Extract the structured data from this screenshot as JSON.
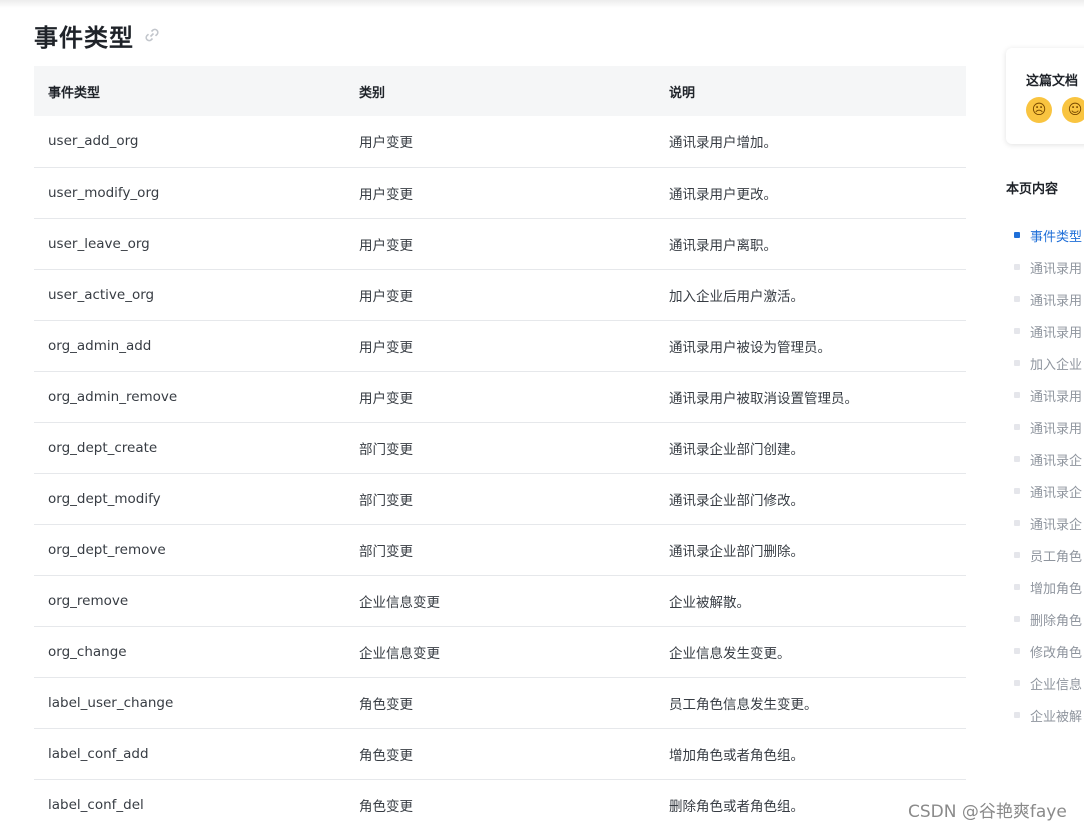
{
  "header": {
    "title": "事件类型",
    "link_icon": "link-icon"
  },
  "table": {
    "columns": [
      "事件类型",
      "类别",
      "说明"
    ],
    "rows": [
      [
        "user_add_org",
        "用户变更",
        "通讯录用户增加。"
      ],
      [
        "user_modify_org",
        "用户变更",
        "通讯录用户更改。"
      ],
      [
        "user_leave_org",
        "用户变更",
        "通讯录用户离职。"
      ],
      [
        "user_active_org",
        "用户变更",
        "加入企业后用户激活。"
      ],
      [
        "org_admin_add",
        "用户变更",
        "通讯录用户被设为管理员。"
      ],
      [
        "org_admin_remove",
        "用户变更",
        "通讯录用户被取消设置管理员。"
      ],
      [
        "org_dept_create",
        "部门变更",
        "通讯录企业部门创建。"
      ],
      [
        "org_dept_modify",
        "部门变更",
        "通讯录企业部门修改。"
      ],
      [
        "org_dept_remove",
        "部门变更",
        "通讯录企业部门删除。"
      ],
      [
        "org_remove",
        "企业信息变更",
        "企业被解散。"
      ],
      [
        "org_change",
        "企业信息变更",
        "企业信息发生变更。"
      ],
      [
        "label_user_change",
        "角色变更",
        "员工角色信息发生变更。"
      ],
      [
        "label_conf_add",
        "角色变更",
        "增加角色或者角色组。"
      ],
      [
        "label_conf_del",
        "角色变更",
        "删除角色或者角色组。"
      ]
    ]
  },
  "feedback": {
    "title": "这篇文档",
    "emojis": [
      "crying-face-icon",
      "smiling-face-icon"
    ]
  },
  "toc": {
    "title": "本页内容",
    "items": [
      "事件类型",
      "通讯录用",
      "通讯录用",
      "通讯录用",
      "加入企业",
      "通讯录用",
      "通讯录用",
      "通讯录企",
      "通讯录企",
      "通讯录企",
      "员工角色",
      "增加角色",
      "删除角色",
      "修改角色",
      "企业信息",
      "企业被解"
    ],
    "active_index": 0
  },
  "watermark": "CSDN @谷艳爽faye",
  "colors": {
    "accent": "#1f6fd8",
    "header_bg": "#f5f6f7",
    "divider": "#e6e8eb"
  }
}
